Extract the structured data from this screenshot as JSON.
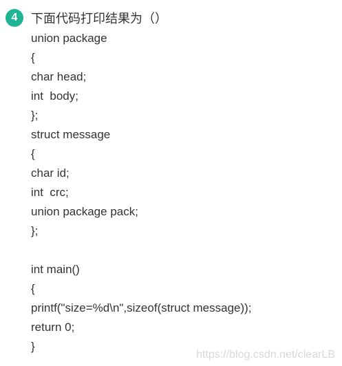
{
  "question": {
    "number": "4",
    "title": "下面代码打印结果为（）"
  },
  "code": {
    "lines": [
      "union package",
      "{",
      "char head;",
      "int  body;",
      "};",
      "struct message",
      "{",
      "char id;",
      "int  crc;",
      "union package pack;",
      "};",
      "",
      "int main()",
      "{",
      "printf(\"size=%d\\n\",sizeof(struct message));",
      "return 0;",
      "}"
    ]
  },
  "watermark": "https://blog.csdn.net/clearLB",
  "colors": {
    "badge": "#1fb594",
    "text": "#333333",
    "watermark": "#d8d8d8"
  }
}
